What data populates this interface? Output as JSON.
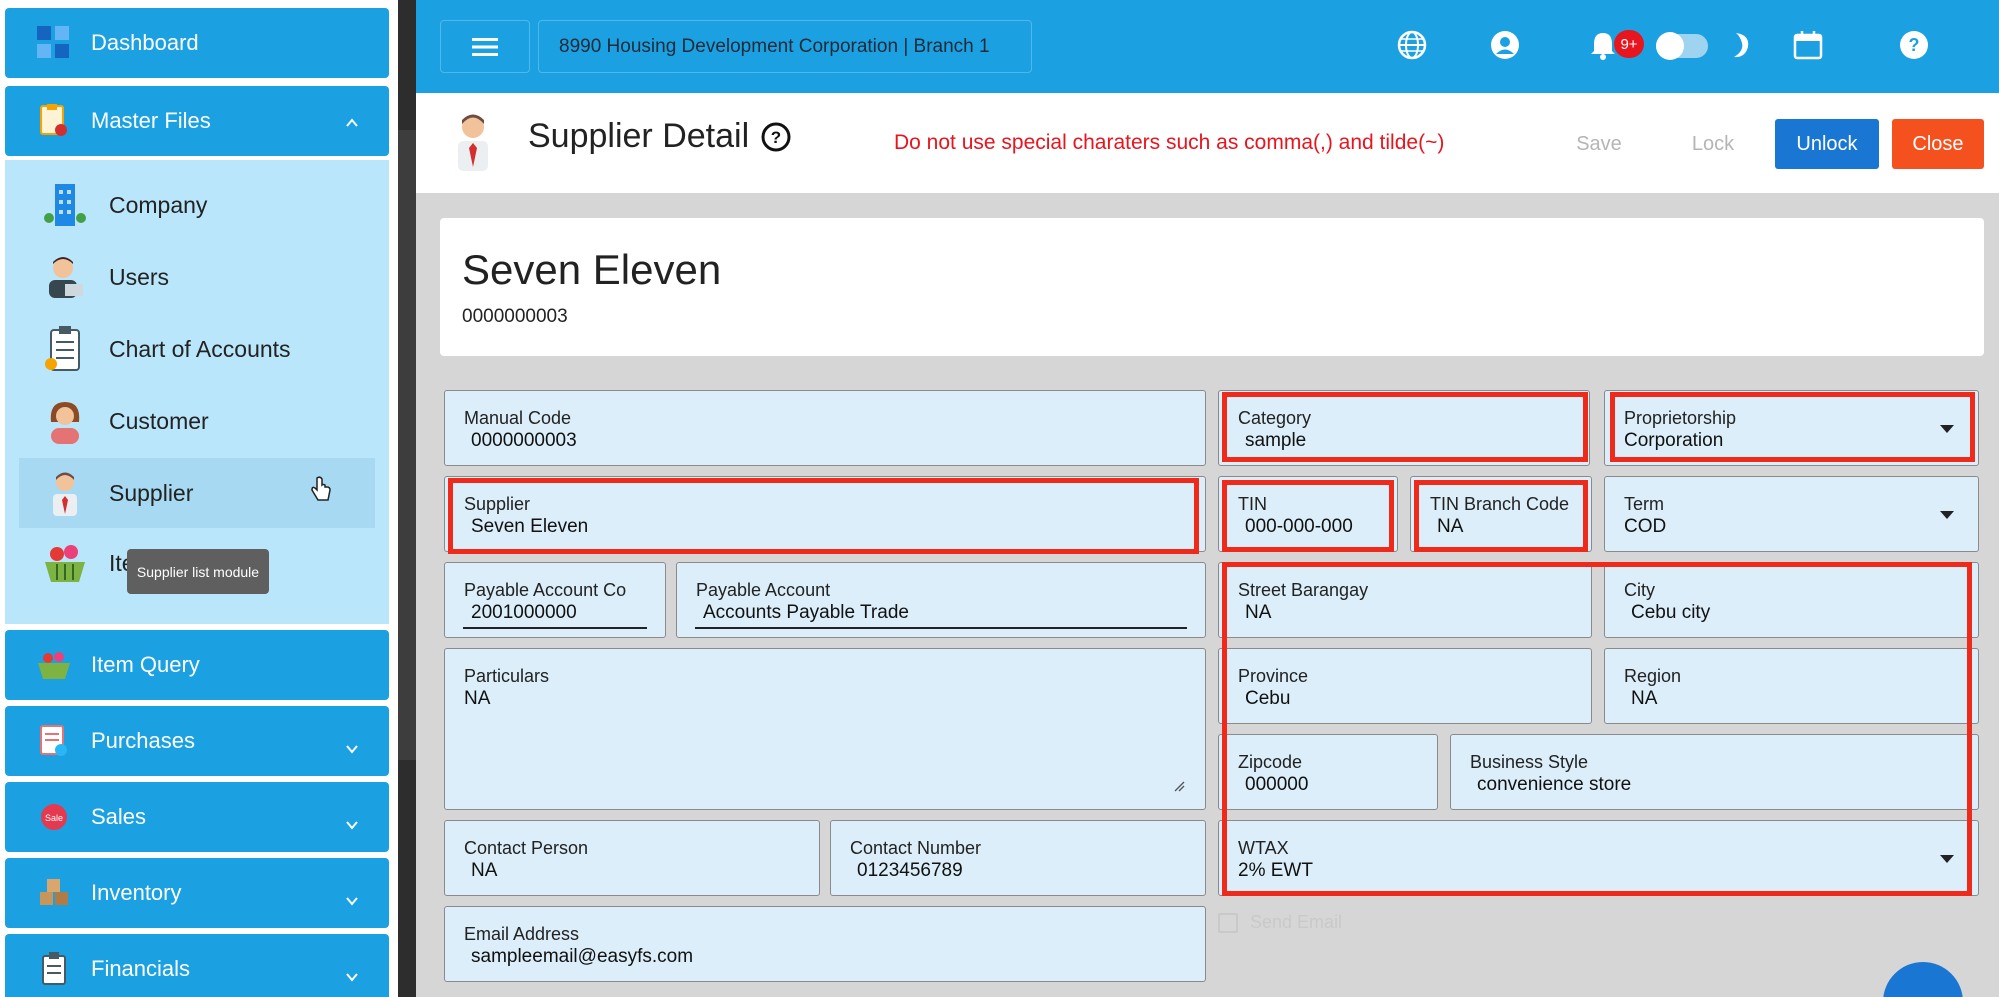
{
  "sidebar": {
    "dashboard": "Dashboard",
    "master_files": "Master Files",
    "sub_items": [
      {
        "label": "Company",
        "icon": "building-icon"
      },
      {
        "label": "Users",
        "icon": "user-laptop-icon"
      },
      {
        "label": "Chart of Accounts",
        "icon": "clipboard-icon"
      },
      {
        "label": "Customer",
        "icon": "customer-icon"
      },
      {
        "label": "Supplier",
        "icon": "supplier-icon"
      },
      {
        "label": "Ite",
        "icon": "basket-icon"
      }
    ],
    "tooltip": "Supplier list module",
    "groups": [
      {
        "label": "Item Query"
      },
      {
        "label": "Purchases"
      },
      {
        "label": "Sales"
      },
      {
        "label": "Inventory"
      },
      {
        "label": "Financials"
      }
    ]
  },
  "topbar": {
    "company": "8990 Housing Development Corporation | Branch 1",
    "notif_count": "9+"
  },
  "header": {
    "title": "Supplier Detail",
    "warning": "Do not use special charaters such as comma(,) and tilde(~)",
    "save": "Save",
    "lock": "Lock",
    "unlock": "Unlock",
    "close": "Close"
  },
  "card": {
    "name": "Seven Eleven",
    "code": "0000000003"
  },
  "form": {
    "manual_code": {
      "label": "Manual Code",
      "value": "0000000003"
    },
    "category": {
      "label": "Category",
      "value": "sample"
    },
    "proprietorship": {
      "label": "Proprietorship",
      "value": "Corporation"
    },
    "supplier": {
      "label": "Supplier",
      "value": "Seven Eleven"
    },
    "tin": {
      "label": "TIN",
      "value": "000-000-000"
    },
    "tin_branch": {
      "label": "TIN Branch Code",
      "value": "NA"
    },
    "term": {
      "label": "Term",
      "value": "COD"
    },
    "payable_code": {
      "label": "Payable Account Co",
      "value": "2001000000"
    },
    "payable_account": {
      "label": "Payable Account",
      "value": "Accounts Payable Trade"
    },
    "street": {
      "label": "Street Barangay",
      "value": "NA"
    },
    "city": {
      "label": "City",
      "value": "Cebu city"
    },
    "particulars": {
      "label": "Particulars",
      "value": "NA"
    },
    "province": {
      "label": "Province",
      "value": "Cebu"
    },
    "region": {
      "label": "Region",
      "value": "NA"
    },
    "zipcode": {
      "label": "Zipcode",
      "value": "000000"
    },
    "business_style": {
      "label": "Business Style",
      "value": "convenience store"
    },
    "contact_person": {
      "label": "Contact Person",
      "value": "NA"
    },
    "contact_number": {
      "label": "Contact Number",
      "value": "0123456789"
    },
    "wtax": {
      "label": "WTAX",
      "value": "2% EWT"
    },
    "email": {
      "label": "Email Address",
      "value": "sampleemail@easyfs.com"
    },
    "send_email": "Send Email"
  },
  "colors": {
    "primary": "#1ba1e2",
    "highlight": "#f02a1a",
    "unlock": "#1976d2",
    "close": "#f4511e"
  }
}
